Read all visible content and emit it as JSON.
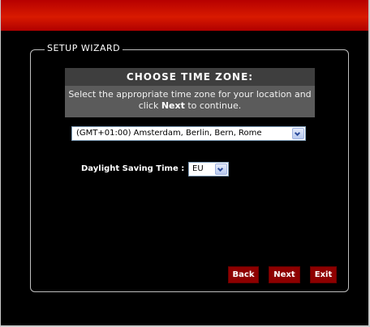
{
  "wizard": {
    "legend": "SETUP WIZARD"
  },
  "header": {
    "title": "CHOOSE TIME ZONE:",
    "desc_before": "Select the appropriate time zone for your location and click ",
    "desc_bold": "Next",
    "desc_after": " to continue."
  },
  "timezone": {
    "selected": "(GMT+01:00) Amsterdam, Berlin, Bern, Rome"
  },
  "dst": {
    "label": "Daylight Saving Time :",
    "selected": "EU"
  },
  "buttons": {
    "back": "Back",
    "next": "Next",
    "exit": "Exit"
  },
  "colors": {
    "topbar": "#c80000",
    "button_bg": "#8e0000",
    "header_title_bg": "#3e3e3e",
    "header_bg": "#5b5b5b"
  },
  "icons": {
    "dropdown": "chevron-down-icon"
  }
}
